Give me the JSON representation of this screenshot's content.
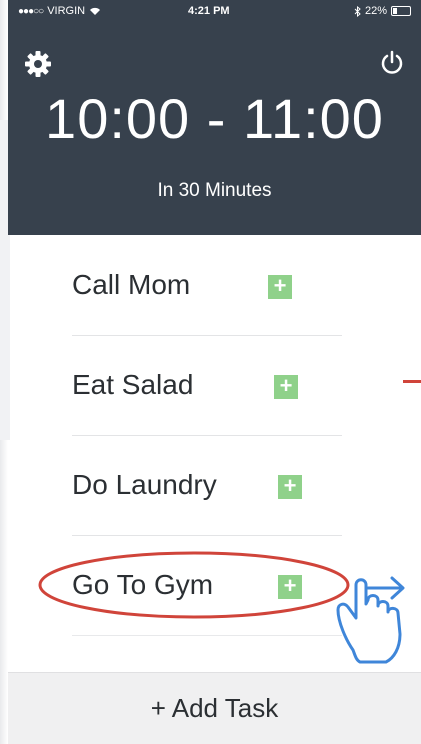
{
  "status": {
    "carrier": "VIRGIN",
    "time": "4:21 PM",
    "battery": "22%"
  },
  "header": {
    "time_range": "10:00 - 11:00",
    "subtitle": "In 30 Minutes",
    "bg_color": "#37414d"
  },
  "tasks": [
    {
      "label": "Call Mom"
    },
    {
      "label": "Eat Salad"
    },
    {
      "label": "Do Laundry"
    },
    {
      "label": "Go To Gym"
    }
  ],
  "footer": {
    "add_label": "+ Add Task"
  },
  "icons": {
    "settings": "gear-icon",
    "power": "power-icon",
    "add": "plus-icon",
    "gesture": "swipe-hand-icon"
  },
  "colors": {
    "accent_green": "#8fd18a",
    "highlight_red": "#d0443a",
    "gesture_blue": "#3f86d9"
  }
}
